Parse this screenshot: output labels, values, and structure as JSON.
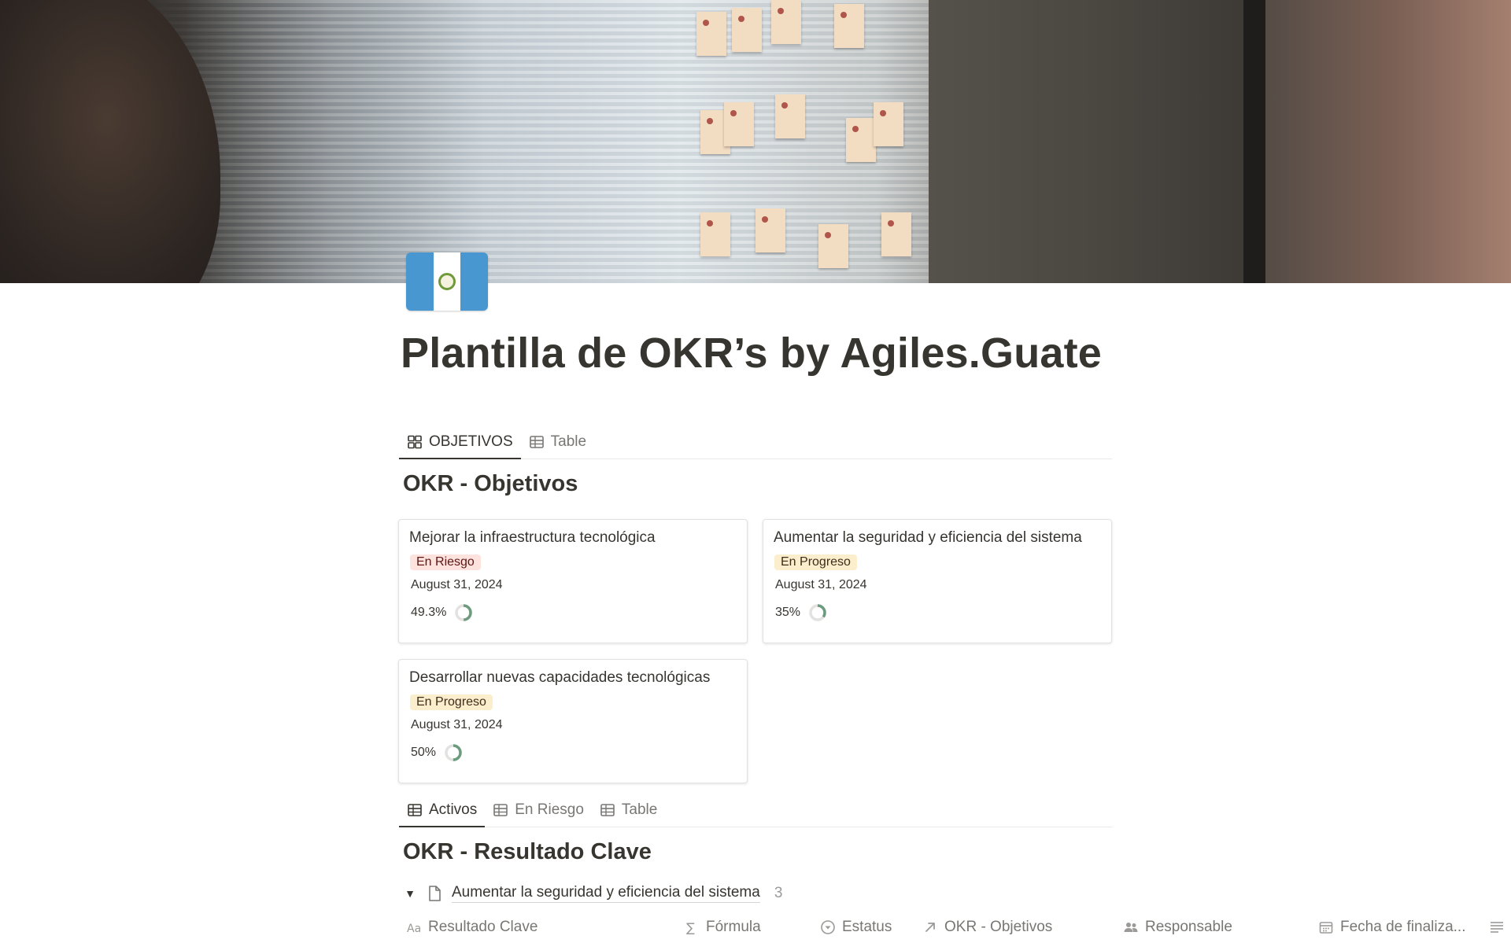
{
  "page": {
    "title": "Plantilla de OKR’s by Agiles.Guate",
    "icon": "guatemala-flag-icon"
  },
  "objectives_view": {
    "tabs": [
      {
        "label": "OBJETIVOS",
        "icon": "gallery-icon",
        "active": true
      },
      {
        "label": "Table",
        "icon": "table-icon",
        "active": false
      }
    ],
    "title": "OKR - Objetivos",
    "cards": [
      {
        "title": "Mejorar la infraestructura tecnológica",
        "status": "En Riesgo",
        "date": "August 31, 2024",
        "progress_label": "49.3%",
        "progress": 0.493
      },
      {
        "title": "Aumentar la seguridad y eficiencia del sistema",
        "status": "En Progreso",
        "date": "August 31, 2024",
        "progress_label": "35%",
        "progress": 0.35
      },
      {
        "title": "Desarrollar nuevas capacidades tecnológicas",
        "status": "En Progreso",
        "date": "August 31, 2024",
        "progress_label": "50%",
        "progress": 0.5
      }
    ]
  },
  "key_results_view": {
    "tabs": [
      {
        "label": "Activos",
        "icon": "table-icon",
        "active": true
      },
      {
        "label": "En Riesgo",
        "icon": "table-icon",
        "active": false
      },
      {
        "label": "Table",
        "icon": "table-icon",
        "active": false
      }
    ],
    "title": "OKR - Resultado Clave",
    "group": {
      "label": "Aumentar la seguridad y eficiencia del sistema",
      "count": "3"
    },
    "columns": [
      {
        "label": "Resultado Clave",
        "icon": "text-property-icon"
      },
      {
        "label": "Fórmula",
        "icon": "formula-icon"
      },
      {
        "label": "Estatus",
        "icon": "status-icon"
      },
      {
        "label": "OKR - Objetivos",
        "icon": "relation-icon"
      },
      {
        "label": "Responsable",
        "icon": "people-icon"
      },
      {
        "label": "Fecha de finaliza...",
        "icon": "calendar-icon"
      },
      {
        "label": "",
        "icon": "text-lines-icon"
      }
    ]
  },
  "colors": {
    "text": "#37352f",
    "muted": "#787774",
    "risk_bg": "#fde2dd",
    "risk_text": "#5d1715",
    "progress_bg": "#fbeecc",
    "progress_text": "#402c1b",
    "ring_fill": "#6c9b7d",
    "ring_track": "#e3e2e0"
  }
}
